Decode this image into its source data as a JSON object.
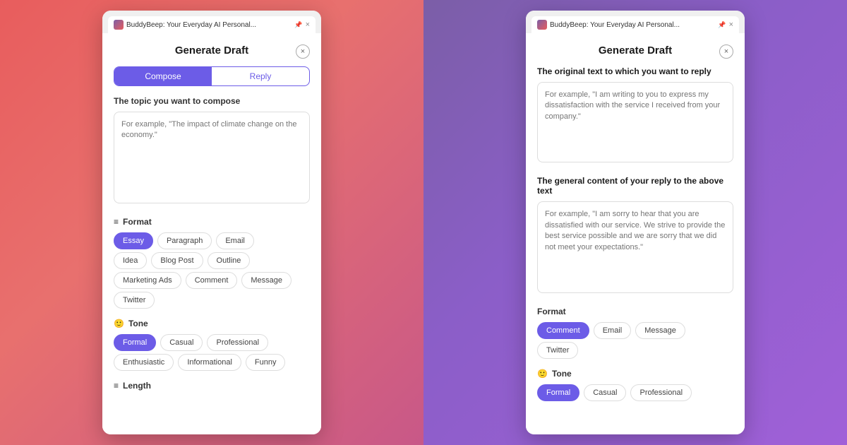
{
  "left_panel": {
    "browser_tab": {
      "title": "BuddyBeep: Your Everyday AI Personal...",
      "pin_icon": "📌",
      "close_icon": "×"
    },
    "modal": {
      "title": "Generate Draft",
      "close_icon": "×",
      "tabs": [
        {
          "label": "Compose",
          "active": true
        },
        {
          "label": "Reply",
          "active": false
        }
      ],
      "compose_label": "The topic you want to compose",
      "compose_placeholder": "For example, \"The impact of climate change on the economy.\"",
      "format_label": "Format",
      "format_icon": "≡",
      "format_chips": [
        {
          "label": "Essay",
          "active": true
        },
        {
          "label": "Paragraph",
          "active": false
        },
        {
          "label": "Email",
          "active": false
        },
        {
          "label": "Idea",
          "active": false
        },
        {
          "label": "Blog Post",
          "active": false
        },
        {
          "label": "Outline",
          "active": false
        },
        {
          "label": "Marketing Ads",
          "active": false
        },
        {
          "label": "Comment",
          "active": false
        },
        {
          "label": "Message",
          "active": false
        },
        {
          "label": "Twitter",
          "active": false
        }
      ],
      "tone_label": "Tone",
      "tone_icon": "🙂",
      "tone_chips": [
        {
          "label": "Formal",
          "active": true
        },
        {
          "label": "Casual",
          "active": false
        },
        {
          "label": "Professional",
          "active": false
        },
        {
          "label": "Enthusiastic",
          "active": false
        },
        {
          "label": "Informational",
          "active": false
        },
        {
          "label": "Funny",
          "active": false
        }
      ],
      "length_label": "Length",
      "length_icon": "≡"
    }
  },
  "right_panel": {
    "browser_tab": {
      "title": "BuddyBeep: Your Everyday AI Personal...",
      "pin_icon": "📌",
      "close_icon": "×"
    },
    "modal": {
      "title": "Generate Draft",
      "close_icon": "×",
      "original_text_label": "The original text to which you want to reply",
      "original_text_placeholder": "For example, \"I am writing to you to express my dissatisfaction with the service I received from your company.\"",
      "reply_content_label": "The general content of your reply to the above text",
      "reply_content_placeholder": "For example, \"I am sorry to hear that you are dissatisfied with our service. We strive to provide the best service possible and we are sorry that we did not meet your expectations.\"",
      "format_label": "Format",
      "format_chips": [
        {
          "label": "Comment",
          "active": true
        },
        {
          "label": "Email",
          "active": false
        },
        {
          "label": "Message",
          "active": false
        },
        {
          "label": "Twitter",
          "active": false
        }
      ],
      "tone_label": "Tone",
      "tone_icon": "🙂",
      "tone_chips": [
        {
          "label": "Formal",
          "active": true
        },
        {
          "label": "Casual",
          "active": false
        },
        {
          "label": "Professional",
          "active": false
        }
      ]
    }
  }
}
